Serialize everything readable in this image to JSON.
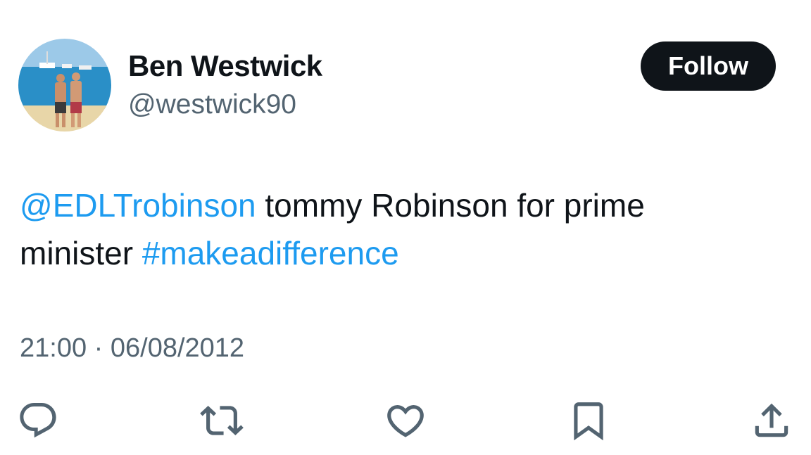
{
  "user": {
    "display_name": "Ben Westwick",
    "handle": "@westwick90",
    "avatar_icon": "profile-photo"
  },
  "follow_button": {
    "label": "Follow"
  },
  "tweet": {
    "mention": "@EDLTrobinson",
    "text_part1": " tommy Robinson for prime minister ",
    "hashtag": "#makeadifference",
    "timestamp": "21:00 · 06/08/2012"
  },
  "actions": [
    {
      "icon": "reply-icon"
    },
    {
      "icon": "retweet-icon"
    },
    {
      "icon": "like-icon"
    },
    {
      "icon": "bookmark-icon"
    },
    {
      "icon": "share-icon"
    }
  ],
  "colors": {
    "link": "#1d9bf0",
    "secondary_text": "#536471",
    "primary_text": "#0f1419",
    "follow_bg": "#0f1419"
  }
}
